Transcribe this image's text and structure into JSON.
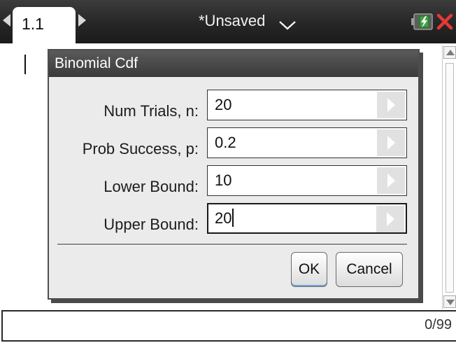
{
  "topbar": {
    "tab_label": "1.1",
    "doc_title": "*Unsaved"
  },
  "icons": {
    "prev_page": "chevron-left-icon",
    "next_page": "chevron-right-icon",
    "doc_menu": "chevron-down-icon",
    "battery": "battery-icon",
    "close": "close-icon"
  },
  "dialog": {
    "title": "Binomial Cdf",
    "fields": [
      {
        "label": "Num Trials, n:",
        "value": "20"
      },
      {
        "label": "Prob Success, p:",
        "value": "0.2"
      },
      {
        "label": "Lower Bound:",
        "value": "10"
      },
      {
        "label": "Upper Bound:",
        "value": "20"
      }
    ],
    "ok_label": "OK",
    "cancel_label": "Cancel"
  },
  "status": {
    "char_count": "0/99"
  },
  "colors": {
    "topbar": "#262626",
    "close_red": "#e53935",
    "battery_green": "#43a047",
    "dialog_header": "#454545",
    "dialog_body": "#ebebeb",
    "focus_accent": "#6ea7d8"
  }
}
